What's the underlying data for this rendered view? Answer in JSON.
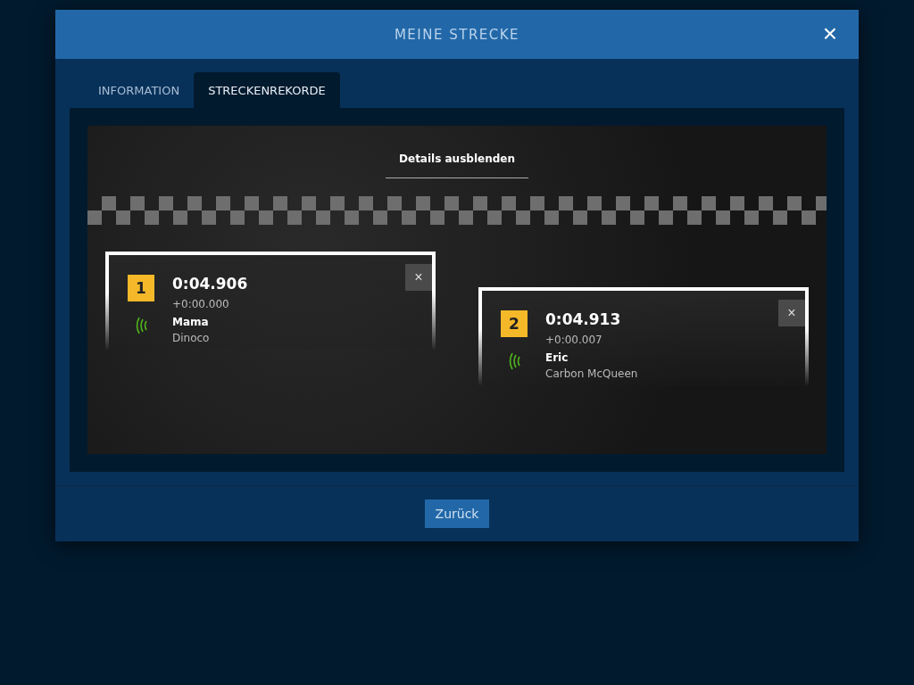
{
  "window": {
    "title": "MEINE STRECKE",
    "close": "×"
  },
  "tabs": [
    {
      "label": "INFORMATION",
      "selected": false
    },
    {
      "label": "STRECKENREKORDE",
      "selected": true
    }
  ],
  "details_toggle": "Details ausblenden",
  "records": [
    {
      "rank": "1",
      "time": "0:04.906",
      "gap": "+0:00.000",
      "driver": "Mama",
      "car": "Dinoco",
      "remove": "×"
    },
    {
      "rank": "2",
      "time": "0:04.913",
      "gap": "+0:00.007",
      "driver": "Eric",
      "car": "Carbon McQueen",
      "remove": "×"
    }
  ],
  "buttons": [
    "Zurück"
  ]
}
